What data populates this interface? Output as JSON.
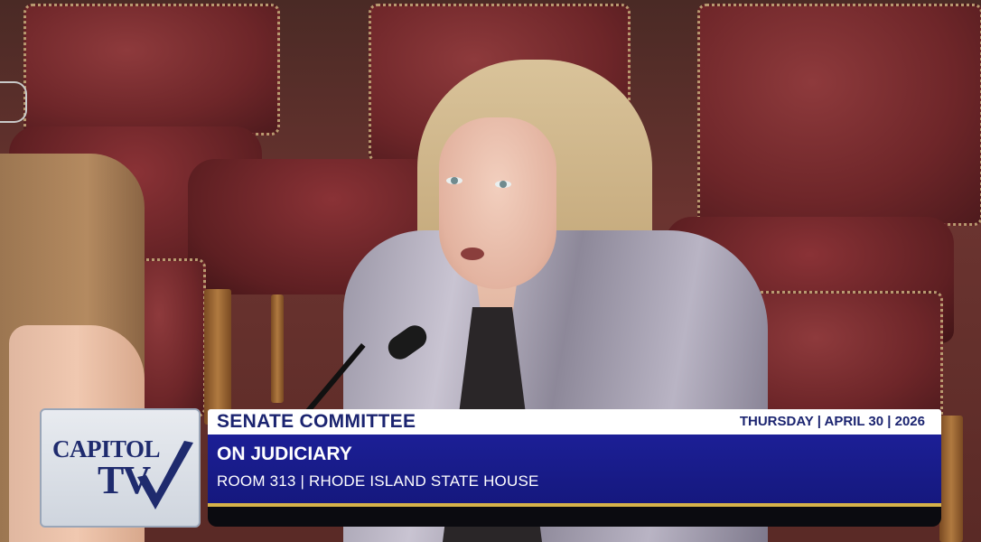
{
  "logo": {
    "line1": "CAPITOL",
    "line2": "TV",
    "check_color": "#1f2b6e"
  },
  "banner": {
    "title": "SENATE COMMITTEE",
    "date": "THURSDAY | APRIL 30 | 2026",
    "subtitle": "ON JUDICIARY",
    "location": "ROOM 313 | RHODE ISLAND STATE HOUSE"
  },
  "colors": {
    "banner_blue": "#1c1f96",
    "title_navy": "#1b2470",
    "accent_gold": "#d6b24a"
  }
}
